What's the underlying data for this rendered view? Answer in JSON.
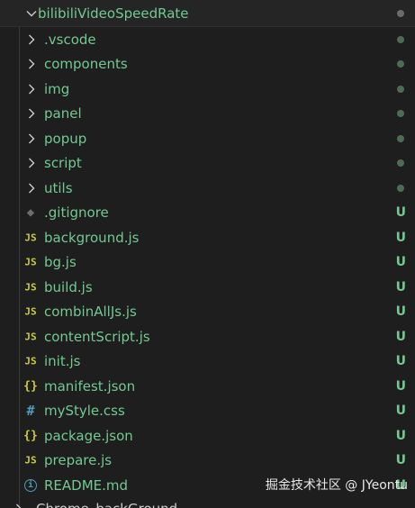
{
  "explorer": {
    "root": {
      "label": "bilibiliVideoSpeedRate",
      "icon": "chevron-down-icon"
    },
    "folders": [
      {
        "label": ".vscode"
      },
      {
        "label": "components"
      },
      {
        "label": "img"
      },
      {
        "label": "panel"
      },
      {
        "label": "popup"
      },
      {
        "label": "script"
      },
      {
        "label": "utils"
      }
    ],
    "files": [
      {
        "label": ".gitignore",
        "icon_glyph": "◆",
        "status": "U"
      },
      {
        "label": "background.js",
        "icon_glyph": "JS",
        "status": "U"
      },
      {
        "label": "bg.js",
        "icon_glyph": "JS",
        "status": "U"
      },
      {
        "label": "build.js",
        "icon_glyph": "JS",
        "status": "U"
      },
      {
        "label": "combinAllJs.js",
        "icon_glyph": "JS",
        "status": "U"
      },
      {
        "label": "contentScript.js",
        "icon_glyph": "JS",
        "status": "U"
      },
      {
        "label": "init.js",
        "icon_glyph": "JS",
        "status": "U"
      },
      {
        "label": "manifest.json",
        "icon_glyph": "{}",
        "status": "U"
      },
      {
        "label": "myStyle.css",
        "icon_glyph": "#",
        "status": "U"
      },
      {
        "label": "package.json",
        "icon_glyph": "{}",
        "status": "U"
      },
      {
        "label": "prepare.js",
        "icon_glyph": "JS",
        "status": "U"
      },
      {
        "label": "README.md",
        "icon_glyph": "i",
        "status": "U"
      }
    ],
    "next_root": {
      "label": "Chrome_backGround"
    }
  },
  "watermark": "掘金技术社区 @ JYeontu",
  "colors": {
    "background": "#1e1e1e",
    "untracked_green": "#73c991",
    "js_yellow": "#cbcb41",
    "css_blue": "#519aba"
  }
}
